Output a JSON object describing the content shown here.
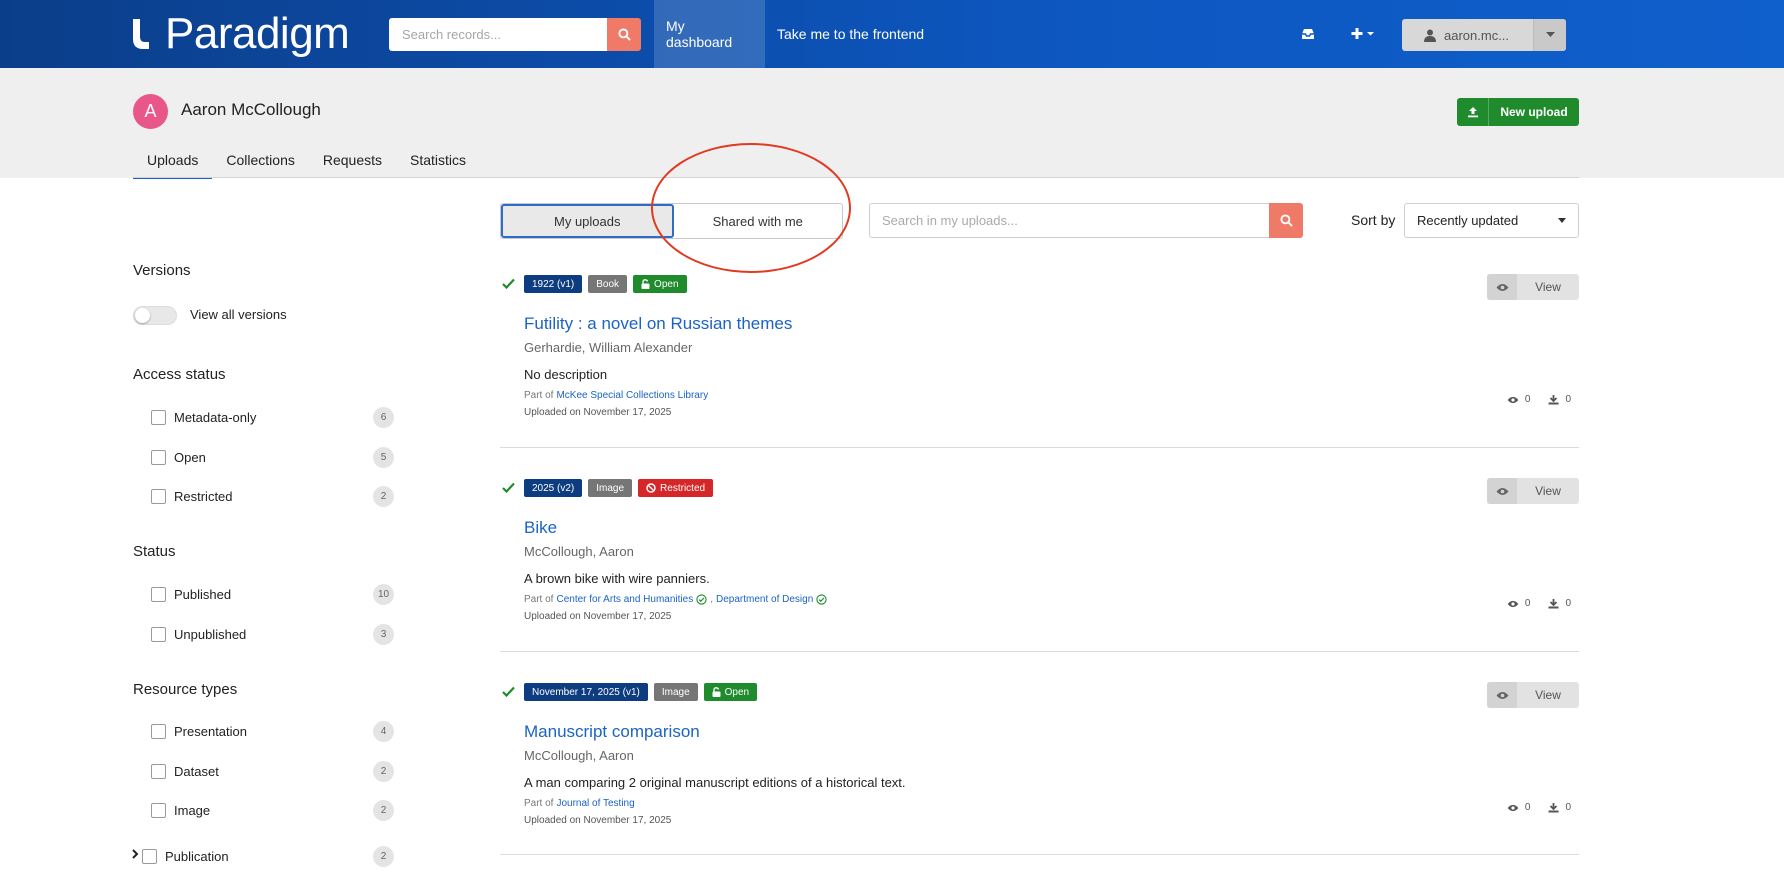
{
  "navbar": {
    "brand": "Paradigm",
    "search_placeholder": "Search records...",
    "dashboard": "My dashboard",
    "frontend": "Take me to the frontend",
    "user": "aaron.mc..."
  },
  "profile": {
    "initial": "A",
    "name": "Aaron McCollough",
    "avatar_color": "#e8568a",
    "new_upload": "New upload"
  },
  "tabs": [
    "Uploads",
    "Collections",
    "Requests",
    "Statistics"
  ],
  "toolbar": {
    "my_uploads": "My uploads",
    "shared": "Shared with me",
    "search_placeholder": "Search in my uploads...",
    "sort_label": "Sort by",
    "sort_value": "Recently updated"
  },
  "filters": {
    "versions": {
      "title": "Versions",
      "toggle": "View all versions"
    },
    "access": {
      "title": "Access status",
      "items": [
        {
          "label": "Metadata-only",
          "count": "6"
        },
        {
          "label": "Open",
          "count": "5"
        },
        {
          "label": "Restricted",
          "count": "2"
        }
      ]
    },
    "status": {
      "title": "Status",
      "items": [
        {
          "label": "Published",
          "count": "10"
        },
        {
          "label": "Unpublished",
          "count": "3"
        }
      ]
    },
    "types": {
      "title": "Resource types",
      "items": [
        {
          "label": "Presentation",
          "count": "4"
        },
        {
          "label": "Dataset",
          "count": "2"
        },
        {
          "label": "Image",
          "count": "2"
        },
        {
          "label": "Publication",
          "count": "2"
        }
      ]
    }
  },
  "results": [
    {
      "version": "1922 (v1)",
      "type": "Book",
      "access": "Open",
      "title": "Futility : a novel on Russian themes",
      "creator": "Gerhardie, William Alexander",
      "description": "No description",
      "part_of_label": "Part of",
      "communities": [
        "McKee Special Collections Library"
      ],
      "uploaded": "Uploaded on November 17, 2025",
      "views": "0",
      "downloads": "0",
      "view_label": "View"
    },
    {
      "version": "2025 (v2)",
      "type": "Image",
      "access": "Restricted",
      "title": "Bike",
      "creator": "McCollough, Aaron",
      "description": "A brown bike with wire panniers.",
      "part_of_label": "Part of",
      "communities": [
        "Center for Arts and Humanities",
        "Department of Design"
      ],
      "uploaded": "Uploaded on November 17, 2025",
      "views": "0",
      "downloads": "0",
      "view_label": "View"
    },
    {
      "version": "November 17, 2025 (v1)",
      "type": "Image",
      "access": "Open",
      "title": "Manuscript comparison",
      "creator": "McCollough, Aaron",
      "description": "A man comparing 2 original manuscript editions of a historical text.",
      "part_of_label": "Part of",
      "communities": [
        "Journal of Testing"
      ],
      "uploaded": "Uploaded on November 17, 2025",
      "views": "0",
      "downloads": "0",
      "view_label": "View"
    }
  ],
  "colors": {
    "navbar": "#0d57c0",
    "accent_search": "#f07a68",
    "open": "#1f8b2c",
    "restricted": "#d52727",
    "version": "#0e3c80",
    "link": "#1b63c6",
    "annotation": "#e03a22"
  }
}
